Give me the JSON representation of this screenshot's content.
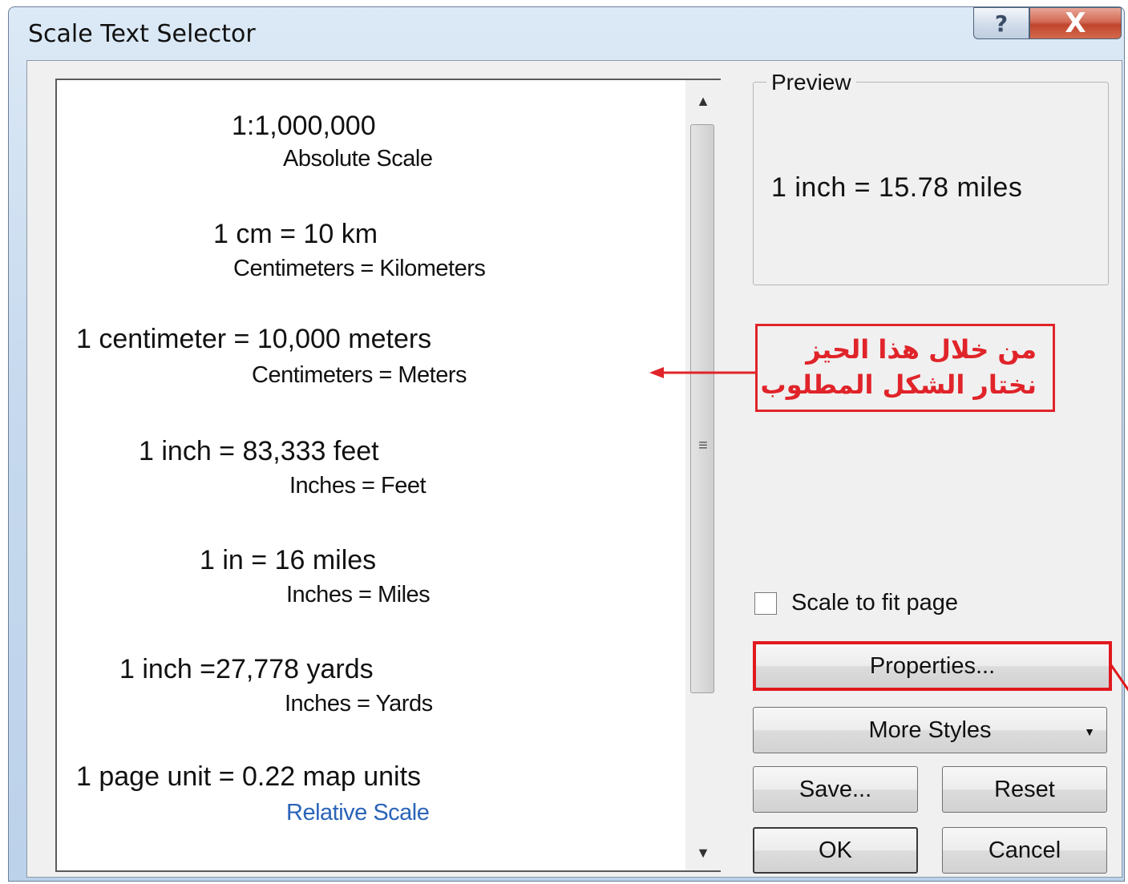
{
  "window": {
    "title": "Scale Text Selector",
    "help_symbol": "?",
    "close_symbol": "X"
  },
  "list": {
    "items": [
      {
        "main": "1:1,000,000",
        "sub": "Absolute Scale"
      },
      {
        "main": "1 cm = 10 km",
        "sub": "Centimeters = Kilometers"
      },
      {
        "main": "1 centimeter = 10,000 meters",
        "sub": "Centimeters = Meters"
      },
      {
        "main": "1 inch = 83,333 feet",
        "sub": "Inches = Feet"
      },
      {
        "main": "1 in = 16 miles",
        "sub": "Inches = Miles"
      },
      {
        "main": "1 inch =27,778 yards",
        "sub": "Inches = Yards"
      },
      {
        "main": "1 page unit = 0.22 map units",
        "sub": "Relative Scale"
      }
    ]
  },
  "preview": {
    "label": "Preview",
    "text": "1 inch = 15.78 miles"
  },
  "annotation": {
    "line1": "من خلال هذا الحيز",
    "line2": "نختار الشكل المطلوب",
    "color": "#e0242a"
  },
  "options": {
    "scale_to_fit_label": "Scale to fit page",
    "scale_to_fit_checked": false
  },
  "buttons": {
    "properties": "Properties...",
    "more_styles": "More Styles",
    "save": "Save...",
    "reset": "Reset",
    "ok": "OK",
    "cancel": "Cancel"
  },
  "icons": {
    "scroll_up": "up-arrow-icon",
    "scroll_down": "down-arrow-icon",
    "dropdown": "caret-down-icon"
  }
}
